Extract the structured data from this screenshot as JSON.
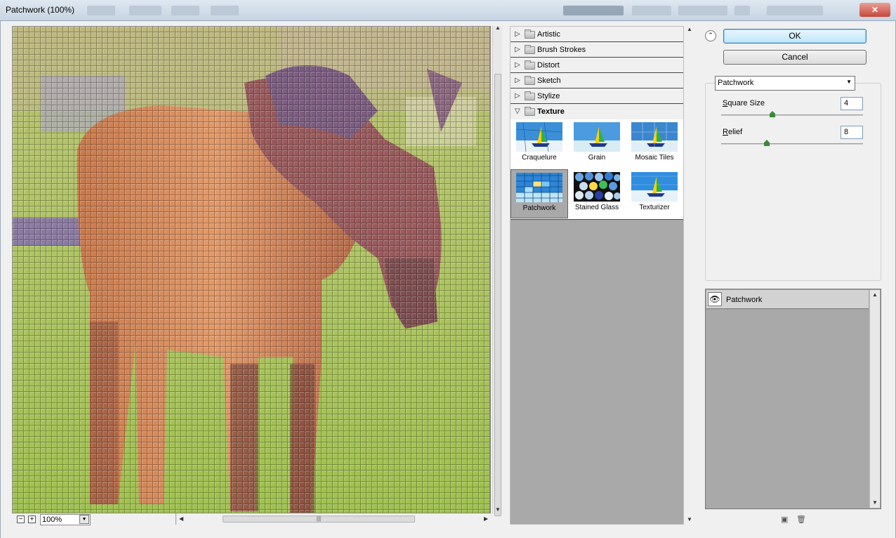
{
  "window": {
    "title": "Patchwork (100%)",
    "close": "✕"
  },
  "preview": {
    "zoom": "100%",
    "minus": "−",
    "plus": "+"
  },
  "categories": [
    {
      "label": "Artistic"
    },
    {
      "label": "Brush Strokes"
    },
    {
      "label": "Distort"
    },
    {
      "label": "Sketch"
    },
    {
      "label": "Stylize"
    },
    {
      "label": "Texture"
    }
  ],
  "texture_filters": [
    {
      "label": "Craquelure"
    },
    {
      "label": "Grain"
    },
    {
      "label": "Mosaic Tiles"
    },
    {
      "label": "Patchwork"
    },
    {
      "label": "Stained Glass"
    },
    {
      "label": "Texturizer"
    }
  ],
  "buttons": {
    "ok": "OK",
    "cancel": "Cancel"
  },
  "settings": {
    "filter_select": "Patchwork",
    "params": [
      {
        "label_key": "S",
        "label_rest": "quare Size",
        "value": "4",
        "level": 0.36
      },
      {
        "label_key": "R",
        "label_rest": "elief",
        "value": "8",
        "level": 0.32
      }
    ]
  },
  "layers": [
    {
      "name": "Patchwork"
    }
  ],
  "colors": {
    "accent": "#3c7fb1",
    "panel": "#a9a9a9",
    "selected": "#d2d2d2"
  }
}
